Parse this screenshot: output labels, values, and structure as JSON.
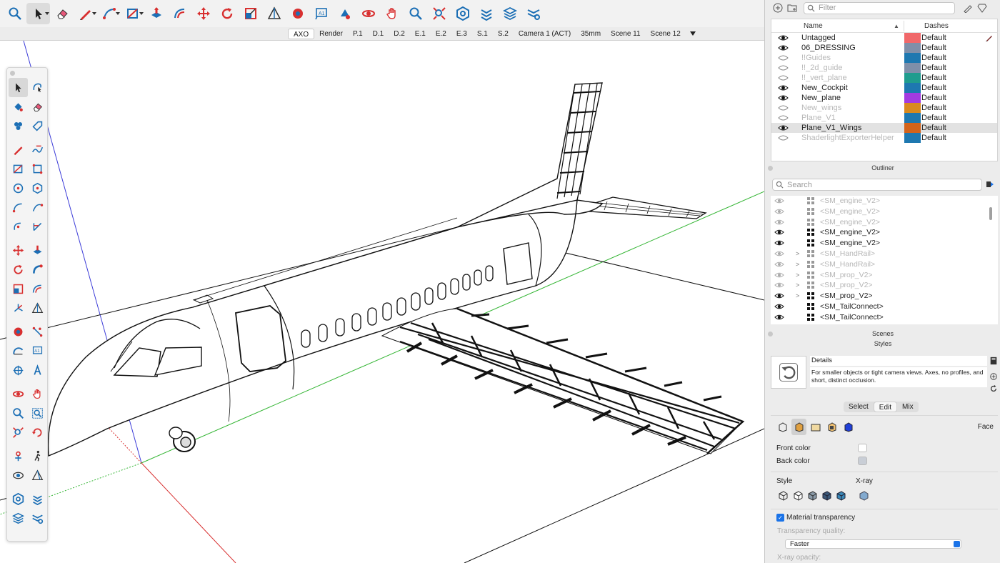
{
  "toolbar": {
    "tools": [
      {
        "icon": "magnify-search-icon"
      },
      {
        "icon": "select-arrow-icon",
        "active": true
      },
      {
        "icon": "eraser-icon"
      },
      {
        "icon": "pencil-line-icon"
      },
      {
        "icon": "arc-icon"
      },
      {
        "icon": "rectangle-icon"
      },
      {
        "icon": "push-pull-icon"
      },
      {
        "icon": "offset-icon"
      },
      {
        "icon": "move-icon"
      },
      {
        "icon": "rotate-icon"
      },
      {
        "icon": "scale-icon"
      },
      {
        "icon": "section-plane-icon"
      },
      {
        "icon": "paint-bucket-icon"
      },
      {
        "icon": "text-label-icon"
      },
      {
        "icon": "orbit-icon"
      },
      {
        "icon": "pan-icon"
      },
      {
        "icon": "zoom-icon"
      },
      {
        "icon": "zoom-extents-icon"
      },
      {
        "icon": "warehouse-icon"
      },
      {
        "icon": "extension-warehouse-icon"
      },
      {
        "icon": "layers-stack-icon"
      },
      {
        "icon": "extension-manager-icon"
      }
    ]
  },
  "scenes": {
    "tabs": [
      "AXO",
      "Render",
      "P.1",
      "D.1",
      "D.2",
      "E.1",
      "E.2",
      "E.3",
      "S.1",
      "S.2",
      "Camera 1 (ACT)",
      "35mm",
      "Scene 11",
      "Scene 12"
    ],
    "active": "AXO"
  },
  "tags": {
    "filter_placeholder": "Filter",
    "col_name": "Name",
    "col_dashes": "Dashes",
    "rows": [
      {
        "name": "Untagged",
        "visible": true,
        "color": "#f0686a",
        "dashes": "Default"
      },
      {
        "name": "06_DRESSING",
        "visible": true,
        "color": "#7f8fa9",
        "dashes": "Default"
      },
      {
        "name": "!!Guides",
        "visible": false,
        "color": "#1e78b0",
        "dashes": "Default"
      },
      {
        "name": "!!_2d_guide",
        "visible": false,
        "color": "#7f8fa9",
        "dashes": "Default"
      },
      {
        "name": "!!_vert_plane",
        "visible": false,
        "color": "#1f9c8e",
        "dashes": "Default"
      },
      {
        "name": "New_Cockpit",
        "visible": true,
        "color": "#1e78b0",
        "dashes": "Default"
      },
      {
        "name": "New_plane",
        "visible": true,
        "color": "#a33be0",
        "dashes": "Default"
      },
      {
        "name": "New_wings",
        "visible": false,
        "color": "#d98a1e",
        "dashes": "Default"
      },
      {
        "name": "Plane_V1",
        "visible": false,
        "color": "#1e78b0",
        "dashes": "Default"
      },
      {
        "name": "Plane_V1_Wings",
        "visible": true,
        "color": "#d2631b",
        "dashes": "Default",
        "selected": true
      },
      {
        "name": "ShaderlightExporterHelper",
        "visible": false,
        "color": "#1e78b0",
        "dashes": "Default"
      }
    ]
  },
  "outliner": {
    "title": "Outliner",
    "search_placeholder": "Search",
    "rows": [
      {
        "name": "<SM_engine_V2>",
        "visible": false,
        "expand": false
      },
      {
        "name": "<SM_engine_V2>",
        "visible": false,
        "expand": false
      },
      {
        "name": "<SM_engine_V2>",
        "visible": false,
        "expand": false
      },
      {
        "name": "<SM_engine_V2>",
        "visible": true,
        "expand": false
      },
      {
        "name": "<SM_engine_V2>",
        "visible": true,
        "expand": false
      },
      {
        "name": "<SM_HandRail>",
        "visible": false,
        "expand": true
      },
      {
        "name": "<SM_HandRail>",
        "visible": false,
        "expand": true
      },
      {
        "name": "<SM_prop_V2>",
        "visible": false,
        "expand": true
      },
      {
        "name": "<SM_prop_V2>",
        "visible": false,
        "expand": true
      },
      {
        "name": "<SM_prop_V2>",
        "visible": true,
        "expand": true
      },
      {
        "name": "<SM_TailConnect>",
        "visible": true,
        "expand": false
      },
      {
        "name": "<SM_TailConnect>",
        "visible": true,
        "expand": false
      }
    ]
  },
  "scenes_panel": {
    "title": "Scenes"
  },
  "styles": {
    "title": "Styles",
    "name": "Details",
    "description": "For smaller objects or tight camera views. Axes, no profiles, and short, distinct occlusion.",
    "tabs": [
      "Select",
      "Edit",
      "Mix"
    ],
    "active_tab": "Edit",
    "section": "Face",
    "front_color_label": "Front color",
    "back_color_label": "Back color",
    "front_color": "#ffffff",
    "back_color": "#c9ced6",
    "style_label": "Style",
    "xray_label": "X-ray",
    "material_transparency_label": "Material transparency",
    "material_transparency": true,
    "transparency_quality_label": "Transparency quality:",
    "transparency_quality": "Faster",
    "xray_opacity_label": "X-ray opacity:"
  }
}
